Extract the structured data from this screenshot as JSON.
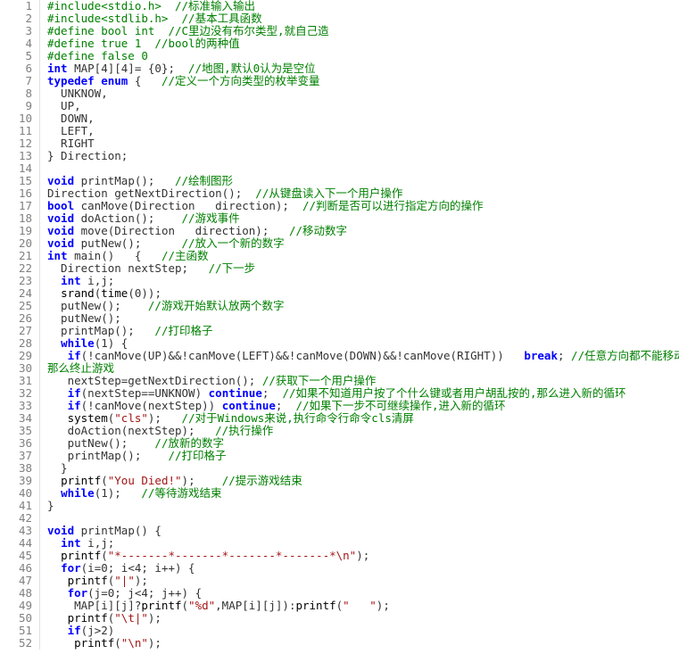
{
  "lines": [
    {
      "n": 1,
      "tokens": [
        [
          "cm",
          "#include<stdio.h>  //标准输入输出"
        ]
      ]
    },
    {
      "n": 2,
      "tokens": [
        [
          "cm",
          "#include<stdlib.h>  //基本工具函数"
        ]
      ]
    },
    {
      "n": 3,
      "tokens": [
        [
          "cm",
          "#define bool int  //C里边没有布尔类型,就自己造"
        ]
      ]
    },
    {
      "n": 4,
      "tokens": [
        [
          "cm",
          "#define true 1  //bool的两种值"
        ]
      ]
    },
    {
      "n": 5,
      "tokens": [
        [
          "cm",
          "#define false 0"
        ]
      ]
    },
    {
      "n": 6,
      "tokens": [
        [
          "kw",
          "int"
        ],
        [
          "",
          " MAP[4][4]= {0};  "
        ],
        [
          "cm",
          "//地图,默认0认为是空位"
        ]
      ]
    },
    {
      "n": 7,
      "tokens": [
        [
          "kw",
          "typedef"
        ],
        [
          "",
          " "
        ],
        [
          "kw",
          "enum"
        ],
        [
          "",
          " {   "
        ],
        [
          "cm",
          "//定义一个方向类型的枚举变量"
        ]
      ]
    },
    {
      "n": 8,
      "tokens": [
        [
          "",
          "  UNKNOW,"
        ]
      ]
    },
    {
      "n": 9,
      "tokens": [
        [
          "",
          "  UP,"
        ]
      ]
    },
    {
      "n": 10,
      "tokens": [
        [
          "",
          "  DOWN,"
        ]
      ]
    },
    {
      "n": 11,
      "tokens": [
        [
          "",
          "  LEFT,"
        ]
      ]
    },
    {
      "n": 12,
      "tokens": [
        [
          "",
          "  RIGHT"
        ]
      ]
    },
    {
      "n": 13,
      "tokens": [
        [
          "",
          "} Direction;"
        ]
      ]
    },
    {
      "n": 14,
      "tokens": [
        [
          "",
          ""
        ]
      ]
    },
    {
      "n": 15,
      "tokens": [
        [
          "kw",
          "void"
        ],
        [
          "",
          " printMap();   "
        ],
        [
          "cm",
          "//绘制图形"
        ]
      ]
    },
    {
      "n": 16,
      "tokens": [
        [
          "",
          "Direction getNextDirection();  "
        ],
        [
          "cm",
          "//从键盘读入下一个用户操作"
        ]
      ]
    },
    {
      "n": 17,
      "tokens": [
        [
          "kw",
          "bool"
        ],
        [
          "",
          " canMove(Direction   direction);  "
        ],
        [
          "cm",
          "//判断是否可以进行指定方向的操作"
        ]
      ]
    },
    {
      "n": 18,
      "tokens": [
        [
          "kw",
          "void"
        ],
        [
          "",
          " doAction();    "
        ],
        [
          "cm",
          "//游戏事件"
        ]
      ]
    },
    {
      "n": 19,
      "tokens": [
        [
          "kw",
          "void"
        ],
        [
          "",
          " move(Direction   direction);   "
        ],
        [
          "cm",
          "//移动数字"
        ]
      ]
    },
    {
      "n": 20,
      "tokens": [
        [
          "kw",
          "void"
        ],
        [
          "",
          " putNew();      "
        ],
        [
          "cm",
          "//放入一个新的数字"
        ]
      ]
    },
    {
      "n": 21,
      "tokens": [
        [
          "kw",
          "int"
        ],
        [
          "",
          " main()   {   "
        ],
        [
          "cm",
          "//主函数"
        ]
      ]
    },
    {
      "n": 22,
      "tokens": [
        [
          "",
          "  Direction nextStep;   "
        ],
        [
          "cm",
          "//下一步"
        ]
      ]
    },
    {
      "n": 23,
      "tokens": [
        [
          "",
          "  "
        ],
        [
          "kw",
          "int"
        ],
        [
          "",
          " i,j;"
        ]
      ]
    },
    {
      "n": 24,
      "tokens": [
        [
          "",
          "  "
        ],
        [
          "fn",
          "srand"
        ],
        [
          "",
          "("
        ],
        [
          "fn",
          "time"
        ],
        [
          "",
          "(0));"
        ]
      ]
    },
    {
      "n": 25,
      "tokens": [
        [
          "",
          "  putNew();    "
        ],
        [
          "cm",
          "//游戏开始默认放两个数字"
        ]
      ]
    },
    {
      "n": 26,
      "tokens": [
        [
          "",
          "  putNew();"
        ]
      ]
    },
    {
      "n": 27,
      "tokens": [
        [
          "",
          "  printMap();   "
        ],
        [
          "cm",
          "//打印格子"
        ]
      ]
    },
    {
      "n": 28,
      "tokens": [
        [
          "",
          "  "
        ],
        [
          "kw",
          "while"
        ],
        [
          "",
          "(1) {"
        ]
      ]
    },
    {
      "n": 29,
      "tokens": [
        [
          "",
          "   "
        ],
        [
          "kw",
          "if"
        ],
        [
          "",
          "(!canMove(UP)&&!canMove(LEFT)&&!canMove(DOWN)&&!canMove(RIGHT))   "
        ],
        [
          "brk",
          "break"
        ],
        [
          "",
          "; "
        ],
        [
          "cm",
          "//任意方向都不能移动,"
        ]
      ]
    },
    {
      "n": 30,
      "tokens": [
        [
          "cm",
          "那么终止游戏"
        ]
      ]
    },
    {
      "n": 31,
      "tokens": [
        [
          "",
          "   nextStep=getNextDirection(); "
        ],
        [
          "cm",
          "//获取下一个用户操作"
        ]
      ]
    },
    {
      "n": 32,
      "tokens": [
        [
          "",
          "   "
        ],
        [
          "kw",
          "if"
        ],
        [
          "",
          "(nextStep==UNKNOW) "
        ],
        [
          "kw",
          "continue"
        ],
        [
          "",
          ";  "
        ],
        [
          "cm",
          "//如果不知道用户按了个什么键或者用户胡乱按的,那么进入新的循环"
        ]
      ]
    },
    {
      "n": 33,
      "tokens": [
        [
          "",
          "   "
        ],
        [
          "kw",
          "if"
        ],
        [
          "",
          "(!canMove(nextStep)) "
        ],
        [
          "kw",
          "continue"
        ],
        [
          "",
          ";  "
        ],
        [
          "cm",
          "//如果下一步不可继续操作,进入新的循环"
        ]
      ]
    },
    {
      "n": 34,
      "tokens": [
        [
          "",
          "   "
        ],
        [
          "fn",
          "system"
        ],
        [
          "",
          "("
        ],
        [
          "st",
          "\"cls\""
        ],
        [
          "",
          ");   "
        ],
        [
          "cm",
          "//对于Windows来说,执行命令行命令cls清屏"
        ]
      ]
    },
    {
      "n": 35,
      "tokens": [
        [
          "",
          "   doAction(nextStep);   "
        ],
        [
          "cm",
          "//执行操作"
        ]
      ]
    },
    {
      "n": 36,
      "tokens": [
        [
          "",
          "   putNew();    "
        ],
        [
          "cm",
          "//放新的数字"
        ]
      ]
    },
    {
      "n": 37,
      "tokens": [
        [
          "",
          "   printMap();    "
        ],
        [
          "cm",
          "//打印格子"
        ]
      ]
    },
    {
      "n": 38,
      "tokens": [
        [
          "",
          "  }"
        ]
      ]
    },
    {
      "n": 39,
      "tokens": [
        [
          "",
          "  "
        ],
        [
          "fn",
          "printf"
        ],
        [
          "",
          "("
        ],
        [
          "st",
          "\"You Died!\""
        ],
        [
          "",
          ");    "
        ],
        [
          "cm",
          "//提示游戏结束"
        ]
      ]
    },
    {
      "n": 40,
      "tokens": [
        [
          "",
          "  "
        ],
        [
          "kw",
          "while"
        ],
        [
          "",
          "(1);   "
        ],
        [
          "cm",
          "//等待游戏结束"
        ]
      ]
    },
    {
      "n": 41,
      "tokens": [
        [
          "",
          "}"
        ]
      ]
    },
    {
      "n": 42,
      "tokens": [
        [
          "",
          ""
        ]
      ]
    },
    {
      "n": 43,
      "tokens": [
        [
          "kw",
          "void"
        ],
        [
          "",
          " printMap() {"
        ]
      ]
    },
    {
      "n": 44,
      "tokens": [
        [
          "",
          "  "
        ],
        [
          "kw",
          "int"
        ],
        [
          "",
          " i,j;"
        ]
      ]
    },
    {
      "n": 45,
      "tokens": [
        [
          "",
          "  "
        ],
        [
          "fn",
          "printf"
        ],
        [
          "",
          "("
        ],
        [
          "st",
          "\"*-------*-------*-------*-------*\\n\""
        ],
        [
          "",
          ");"
        ]
      ]
    },
    {
      "n": 46,
      "tokens": [
        [
          "",
          "  "
        ],
        [
          "kw",
          "for"
        ],
        [
          "",
          "(i=0; i<4; i++) {"
        ]
      ]
    },
    {
      "n": 47,
      "tokens": [
        [
          "",
          "   "
        ],
        [
          "fn",
          "printf"
        ],
        [
          "",
          "("
        ],
        [
          "st",
          "\"|\""
        ],
        [
          "",
          ");"
        ]
      ]
    },
    {
      "n": 48,
      "tokens": [
        [
          "",
          "   "
        ],
        [
          "kw",
          "for"
        ],
        [
          "",
          "(j=0; j<4; j++) {"
        ]
      ]
    },
    {
      "n": 49,
      "tokens": [
        [
          "",
          "    MAP[i][j]?"
        ],
        [
          "fn",
          "printf"
        ],
        [
          "",
          "("
        ],
        [
          "st",
          "\"%d\""
        ],
        [
          "",
          ",MAP[i][j]):"
        ],
        [
          "fn",
          "printf"
        ],
        [
          "",
          "("
        ],
        [
          "st",
          "\"   \""
        ],
        [
          "",
          ");"
        ]
      ]
    },
    {
      "n": 50,
      "tokens": [
        [
          "",
          "   "
        ],
        [
          "fn",
          "printf"
        ],
        [
          "",
          "("
        ],
        [
          "st",
          "\"\\t|\""
        ],
        [
          "",
          ");"
        ]
      ]
    },
    {
      "n": 51,
      "tokens": [
        [
          "",
          "   "
        ],
        [
          "kw",
          "if"
        ],
        [
          "",
          "(j>2)"
        ]
      ]
    },
    {
      "n": 52,
      "tokens": [
        [
          "",
          "    "
        ],
        [
          "fn",
          "printf"
        ],
        [
          "",
          "("
        ],
        [
          "st",
          "\"\\n\""
        ],
        [
          "",
          ");"
        ]
      ]
    }
  ]
}
